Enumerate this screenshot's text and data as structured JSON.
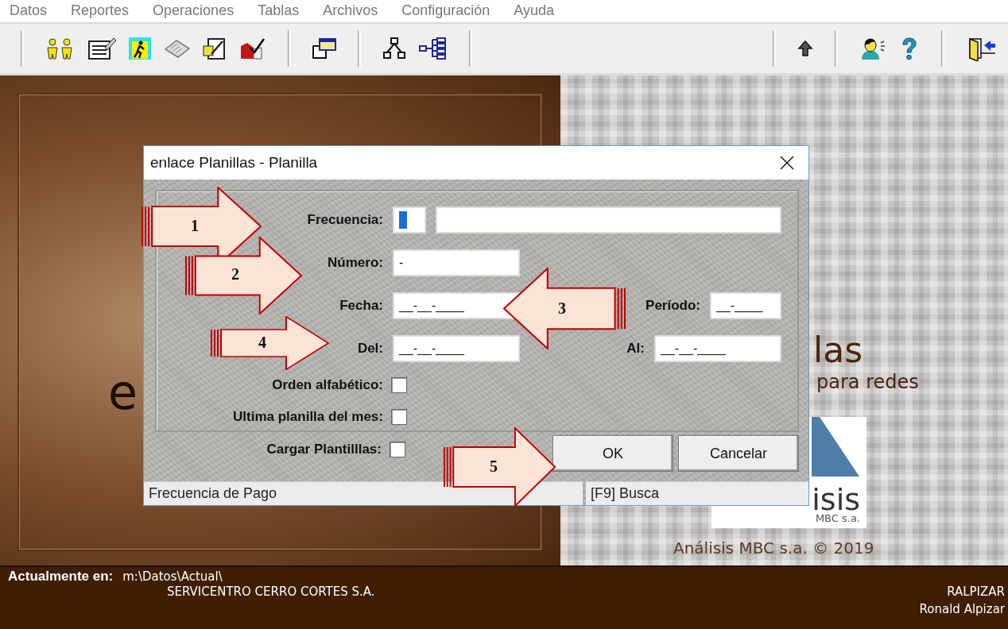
{
  "menu": [
    "Datos",
    "Reportes",
    "Operaciones",
    "Tablas",
    "Archivos",
    "Configuración",
    "Ayuda"
  ],
  "splash": {
    "left_fragment": "e",
    "title_fragment": "las",
    "subtitle_fragment": "para redes",
    "logo_fragment": "isis",
    "logo_sub": "MBC s.a.",
    "copyright": "Análisis MBC s.a. © 2019"
  },
  "dialog": {
    "title": "enlace Planillas - Planilla",
    "rows": [
      {
        "kind": "code_text",
        "label": "Frecuencia:",
        "focused": true
      },
      {
        "kind": "text",
        "label": "Número:",
        "value": "-"
      },
      {
        "kind": "date",
        "label": "Fecha:",
        "value": "__-__-____",
        "extra": {
          "label": "Período:",
          "value": "__-____"
        }
      },
      {
        "kind": "date",
        "label": "Del:",
        "value": "__-__-____",
        "extra": {
          "label": "Al:",
          "value": "__-__-____"
        }
      },
      {
        "kind": "checkbox",
        "label": "Orden alfabético:",
        "checked": false
      },
      {
        "kind": "checkbox",
        "label": "Ultima planilla del mes:",
        "checked": false
      }
    ],
    "cargar": {
      "label": "Cargar Plantilllas:",
      "checked": false
    },
    "buttons": [
      "OK",
      "Cancelar"
    ],
    "status": [
      "Frecuencia de Pago",
      "[F9] Busca"
    ]
  },
  "annotations": [
    {
      "number": "1",
      "kind": "right"
    },
    {
      "number": "2",
      "kind": "right"
    },
    {
      "number": "3",
      "kind": "left"
    },
    {
      "number": "4",
      "kind": "right"
    },
    {
      "number": "5",
      "kind": "right"
    }
  ],
  "footer": {
    "label": "Actualmente en:",
    "path": "m:\\Datos\\Actual\\",
    "company": "SERVICENTRO CERRO CORTES S.A.",
    "user_code": "RALPIZAR",
    "user_name": "Ronald Alpizar"
  }
}
